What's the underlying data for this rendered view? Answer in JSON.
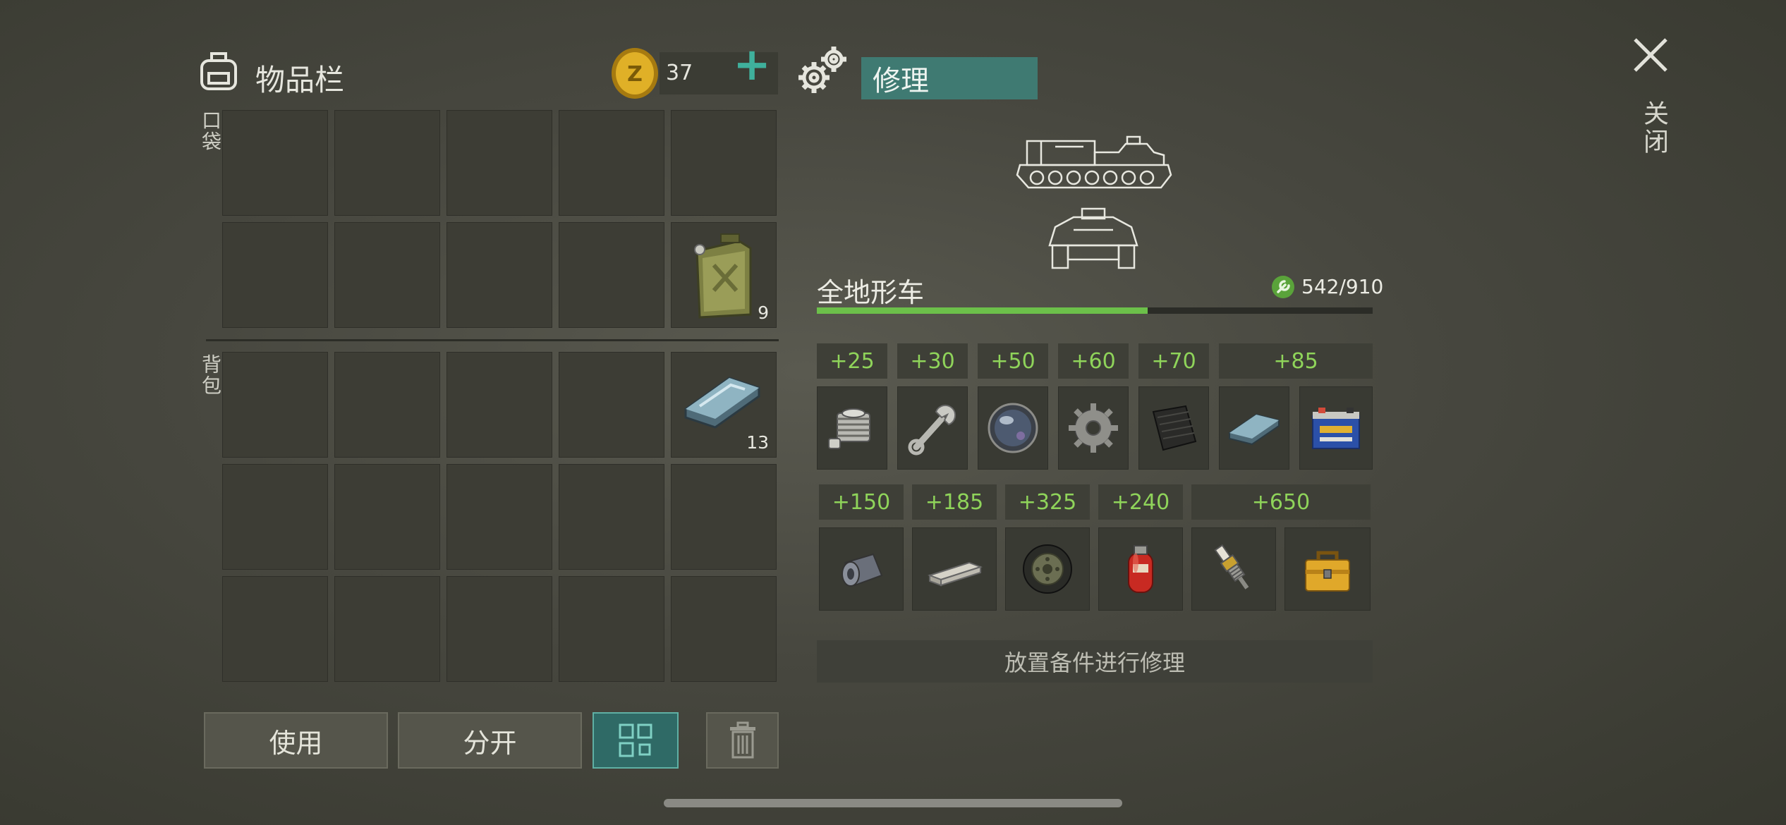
{
  "inventory": {
    "title": "物品栏",
    "pocket_label": "口袋",
    "backpack_label": "背包",
    "coins": "37",
    "add_symbol": "+",
    "pocket_item": {
      "icon": "jerry-can-icon",
      "count": "9"
    },
    "backpack_item": {
      "icon": "metal-ingot-icon",
      "count": "13"
    }
  },
  "buttons": {
    "use": "使用",
    "split": "分开"
  },
  "repair": {
    "tab_label": "修理",
    "vehicle_name": "全地形车",
    "durability_text": "542/910",
    "durability_current": 542,
    "durability_max": 910,
    "values_row1": [
      "+25",
      "+30",
      "+50",
      "+60",
      "+70",
      "+85"
    ],
    "values_row2": [
      "+150",
      "+185",
      "+325",
      "+240",
      "+650"
    ],
    "parts_row1": [
      "engine-cylinder-icon",
      "wrench-icon",
      "glass-lens-icon",
      "gear-icon",
      "rubber-sheet-icon",
      "metal-ingot-icon",
      "car-battery-icon"
    ],
    "parts_row2": [
      "metal-roll-icon",
      "steel-bar-icon",
      "wheel-icon",
      "gas-cylinder-icon",
      "spark-plug-icon",
      "toolbox-icon"
    ],
    "hint": "放置备件进行修理"
  },
  "close_label": "关闭",
  "colors": {
    "accent_teal": "#3f7a72",
    "value_green": "#8fd45a",
    "bar_green": "#6cc04a",
    "coin_gold": "#d9a620"
  }
}
